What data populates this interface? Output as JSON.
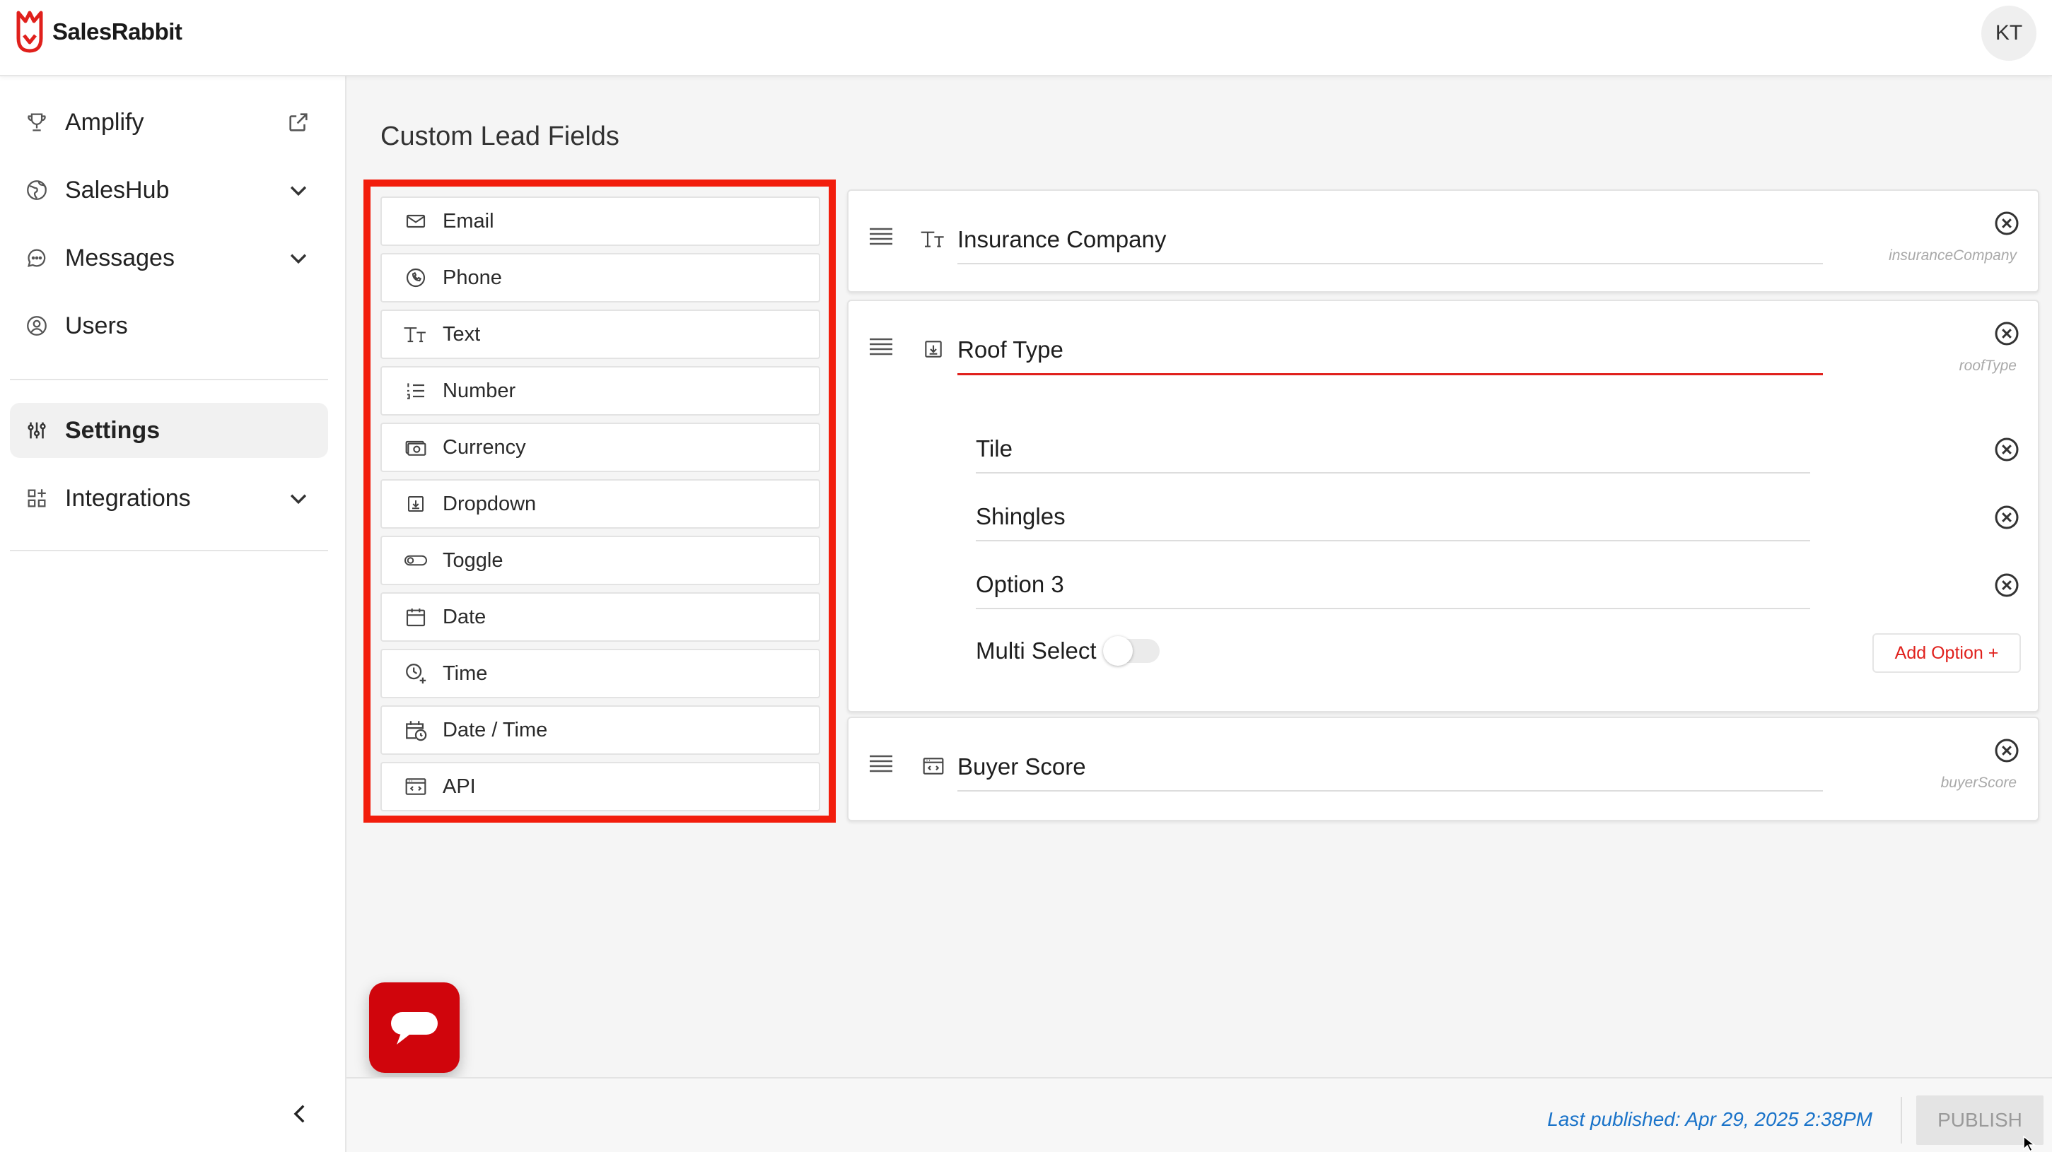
{
  "app": {
    "brand": "SalesRabbit",
    "brand_color": "#e0201c",
    "user_initials": "KT"
  },
  "sidebar": {
    "items": [
      {
        "label": "Amplify",
        "icon": "trophy-icon",
        "trailing": "external-link-icon"
      },
      {
        "label": "SalesHub",
        "icon": "globe-icon",
        "trailing": "chevron-down-icon"
      },
      {
        "label": "Messages",
        "icon": "chat-bubble-icon",
        "trailing": "chevron-down-icon"
      },
      {
        "label": "Users",
        "icon": "user-circle-icon"
      },
      {
        "label": "Settings",
        "icon": "sliders-icon",
        "active": true
      },
      {
        "label": "Integrations",
        "icon": "grid-plus-icon",
        "trailing": "chevron-down-icon"
      }
    ]
  },
  "page": {
    "title": "Custom Lead Fields"
  },
  "palette": {
    "items": [
      {
        "label": "Email",
        "icon": "envelope-icon"
      },
      {
        "label": "Phone",
        "icon": "phone-icon"
      },
      {
        "label": "Text",
        "icon": "text-type-icon"
      },
      {
        "label": "Number",
        "icon": "numbered-list-icon"
      },
      {
        "label": "Currency",
        "icon": "banknote-icon"
      },
      {
        "label": "Dropdown",
        "icon": "dropdown-icon"
      },
      {
        "label": "Toggle",
        "icon": "toggle-icon"
      },
      {
        "label": "Date",
        "icon": "calendar-icon"
      },
      {
        "label": "Time",
        "icon": "clock-plus-icon"
      },
      {
        "label": "Date / Time",
        "icon": "calendar-clock-icon"
      },
      {
        "label": "API",
        "icon": "api-window-icon"
      }
    ],
    "highlight_color": "#f21d0c"
  },
  "fields": {
    "insurance": {
      "name": "Insurance Company",
      "key": "insuranceCompany"
    },
    "roof": {
      "name": "Roof Type",
      "key": "roofType",
      "options": [
        "Tile",
        "Shingles",
        "Option 3"
      ],
      "multi_select_label": "Multi Select",
      "add_option_label": "Add Option +"
    },
    "buyer": {
      "name": "Buyer Score",
      "key": "buyerScore"
    }
  },
  "footer": {
    "last_published": "Last published: Apr 29, 2025 2:38PM",
    "publish_label": "PUBLISH"
  }
}
